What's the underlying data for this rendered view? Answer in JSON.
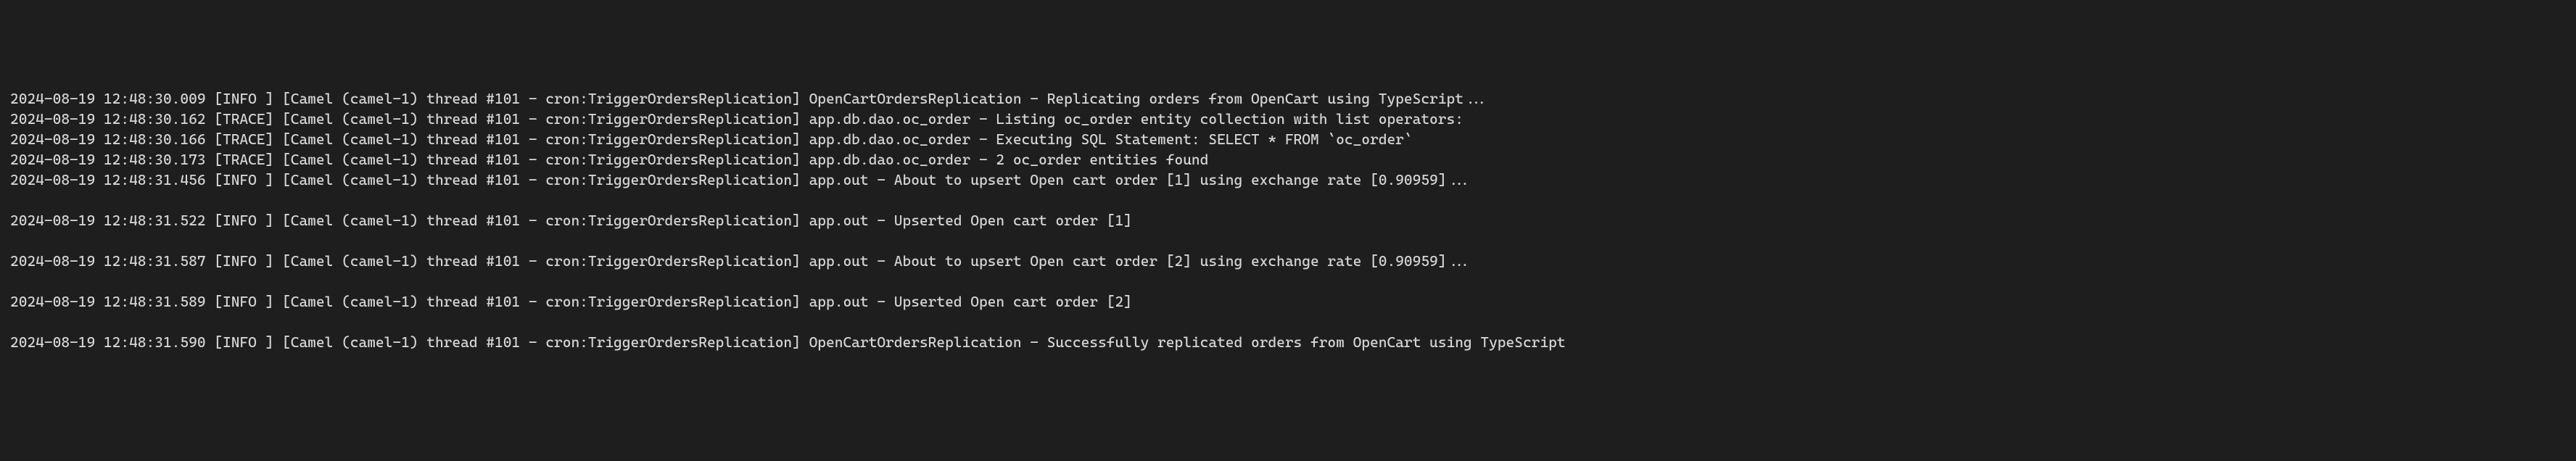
{
  "logs": {
    "lines": [
      "2024-08-19 12:48:30.009 [INFO ] [Camel (camel-1) thread #101 - cron:TriggerOrdersReplication] OpenCartOrdersReplication - Replicating orders from OpenCart using TypeScript...",
      "2024-08-19 12:48:30.162 [TRACE] [Camel (camel-1) thread #101 - cron:TriggerOrdersReplication] app.db.dao.oc_order - Listing oc_order entity collection with list operators:",
      "2024-08-19 12:48:30.166 [TRACE] [Camel (camel-1) thread #101 - cron:TriggerOrdersReplication] app.db.dao.oc_order - Executing SQL Statement: SELECT * FROM `oc_order`",
      "2024-08-19 12:48:30.173 [TRACE] [Camel (camel-1) thread #101 - cron:TriggerOrdersReplication] app.db.dao.oc_order - 2 oc_order entities found",
      "2024-08-19 12:48:31.456 [INFO ] [Camel (camel-1) thread #101 - cron:TriggerOrdersReplication] app.out - About to upsert Open cart order [1] using exchange rate [0.90959]...",
      "",
      "2024-08-19 12:48:31.522 [INFO ] [Camel (camel-1) thread #101 - cron:TriggerOrdersReplication] app.out - Upserted Open cart order [1]",
      "",
      "2024-08-19 12:48:31.587 [INFO ] [Camel (camel-1) thread #101 - cron:TriggerOrdersReplication] app.out - About to upsert Open cart order [2] using exchange rate [0.90959]...",
      "",
      "2024-08-19 12:48:31.589 [INFO ] [Camel (camel-1) thread #101 - cron:TriggerOrdersReplication] app.out - Upserted Open cart order [2]",
      "",
      "2024-08-19 12:48:31.590 [INFO ] [Camel (camel-1) thread #101 - cron:TriggerOrdersReplication] OpenCartOrdersReplication - Successfully replicated orders from OpenCart using TypeScript"
    ]
  }
}
